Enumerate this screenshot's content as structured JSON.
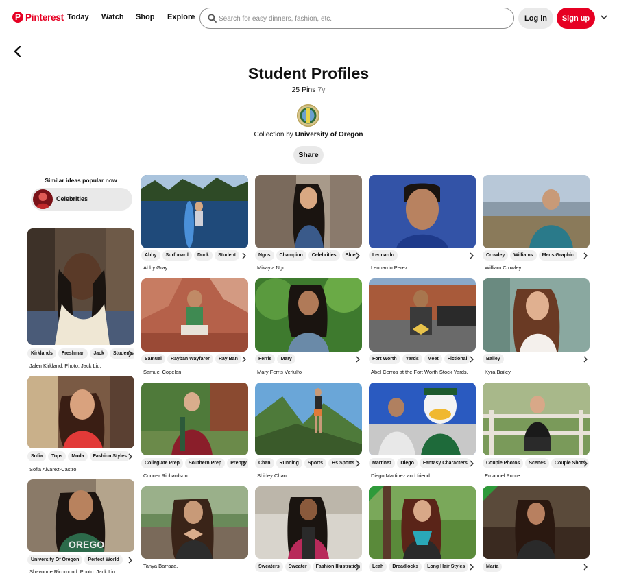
{
  "header": {
    "logo_text": "Pinterest",
    "logo_glyph": "P",
    "nav": [
      "Today",
      "Watch",
      "Shop",
      "Explore"
    ],
    "search_placeholder": "Search for easy dinners, fashion, etc.",
    "login_label": "Log in",
    "signup_label": "Sign up"
  },
  "board": {
    "title": "Student Profiles",
    "pin_count": "25 Pins",
    "age": "7y",
    "collection_prefix": "Collection by",
    "owner": "University of Oregon",
    "share_label": "Share"
  },
  "similar": {
    "title": "Similar ideas popular now",
    "chip_label": "Celebrities"
  },
  "colors": {
    "brand": "#e60023",
    "chip_bg": "#efefef",
    "button_bg": "#e9e9e9"
  },
  "pins": [
    {
      "tags": [
        "Kirklands",
        "Freshman",
        "Jack",
        "Students"
      ],
      "caption": "Jalen Kirkland. Photo: Jack Liu."
    },
    {
      "tags": [
        "Sofia",
        "Tops",
        "Moda",
        "Fashion Styles"
      ],
      "caption": "Sofia Alvarez-Castro"
    },
    {
      "tags": [
        "University Of Oregon",
        "Perfect World"
      ],
      "caption": "Shavonne Richmond. Photo: Jack Liu."
    },
    {
      "tags": [
        "Abby",
        "Surfboard",
        "Duck",
        "Student"
      ],
      "caption": "Abby Gray"
    },
    {
      "tags": [
        "Samuel",
        "Rayban Wayfarer",
        "Ray Ban"
      ],
      "caption": "Samuel Copelan."
    },
    {
      "tags": [
        "Collegiate Prep",
        "Southern Prep",
        "Preppy"
      ],
      "caption": "Conner Richardson."
    },
    {
      "tags": [],
      "caption": "Tanya Barraza."
    },
    {
      "tags": [
        "Ngos",
        "Champion",
        "Celebrities",
        "Blue"
      ],
      "caption": "Mikayla Ngo."
    },
    {
      "tags": [
        "Ferris",
        "Mary"
      ],
      "caption": "Mary Ferris Verlulfo"
    },
    {
      "tags": [
        "Chan",
        "Running",
        "Sports",
        "Hs Sports"
      ],
      "caption": "Shirley Chan."
    },
    {
      "tags": [
        "Sweaters",
        "Sweater",
        "Fashion Illustration"
      ],
      "caption": ""
    },
    {
      "tags": [
        "Leonardo"
      ],
      "caption": "Leonardo Perez."
    },
    {
      "tags": [
        "Fort Worth",
        "Yards",
        "Meet",
        "Fictional"
      ],
      "caption": "Abel Cerros at the Fort Worth Stock Yards."
    },
    {
      "tags": [
        "Martinez",
        "Diego",
        "Fantasy Characters"
      ],
      "caption": "Diego Martinez and friend."
    },
    {
      "tags": [
        "Leah",
        "Dreadlocks",
        "Long Hair Styles"
      ],
      "caption": ""
    },
    {
      "tags": [
        "Crowley",
        "Williams",
        "Mens Graphic"
      ],
      "caption": "William Crowley."
    },
    {
      "tags": [
        "Bailey"
      ],
      "caption": "Kyra Bailey"
    },
    {
      "tags": [
        "Couple Photos",
        "Scenes",
        "Couple Shots"
      ],
      "caption": "Emanuel Purce."
    },
    {
      "tags": [
        "Maria"
      ],
      "caption": ""
    }
  ]
}
